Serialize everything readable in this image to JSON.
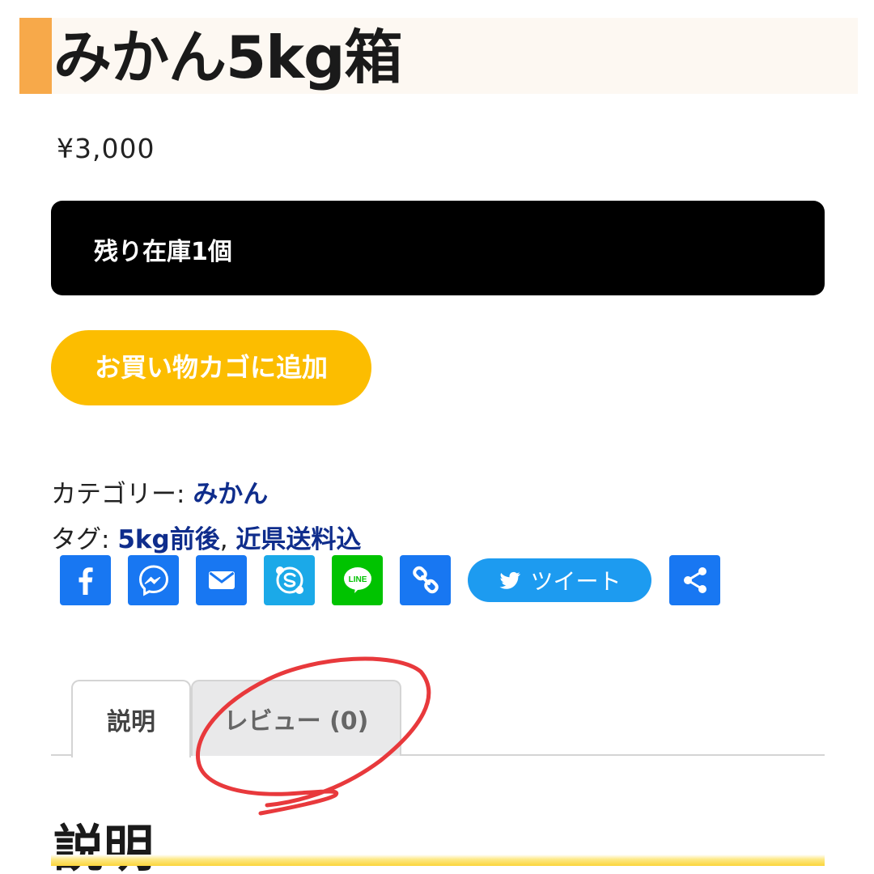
{
  "product": {
    "title": "みかん5kg箱",
    "price": "¥3,000",
    "stock": "残り在庫1個",
    "add_to_cart": "お買い物カゴに追加"
  },
  "meta": {
    "category_label": "カテゴリー: ",
    "category": "みかん",
    "tag_label": "タグ: ",
    "tags": [
      "5kg前後",
      "近県送料込"
    ],
    "tag_separator": ", "
  },
  "share": {
    "buttons": [
      {
        "name": "facebook-icon",
        "color": "#1877f2"
      },
      {
        "name": "messenger-icon",
        "color": "#1877f2"
      },
      {
        "name": "email-icon",
        "color": "#1877f2"
      },
      {
        "name": "skype-icon",
        "color": "#1ba9e8"
      },
      {
        "name": "line-icon",
        "color": "#00c300"
      },
      {
        "name": "copy-link-icon",
        "color": "#1877f2"
      },
      {
        "name": "share-icon",
        "color": "#1877f2"
      }
    ],
    "tweet_label": "ツイート"
  },
  "tabs": [
    {
      "label": "説明",
      "active": true
    },
    {
      "label": "レビュー (0)",
      "active": false
    }
  ],
  "section": {
    "title": "説明"
  },
  "colors": {
    "title_accent": "#f7a94a",
    "cart_button": "#fcbd00",
    "link": "#0f2d8c",
    "annotation_circle": "#e8393c"
  }
}
